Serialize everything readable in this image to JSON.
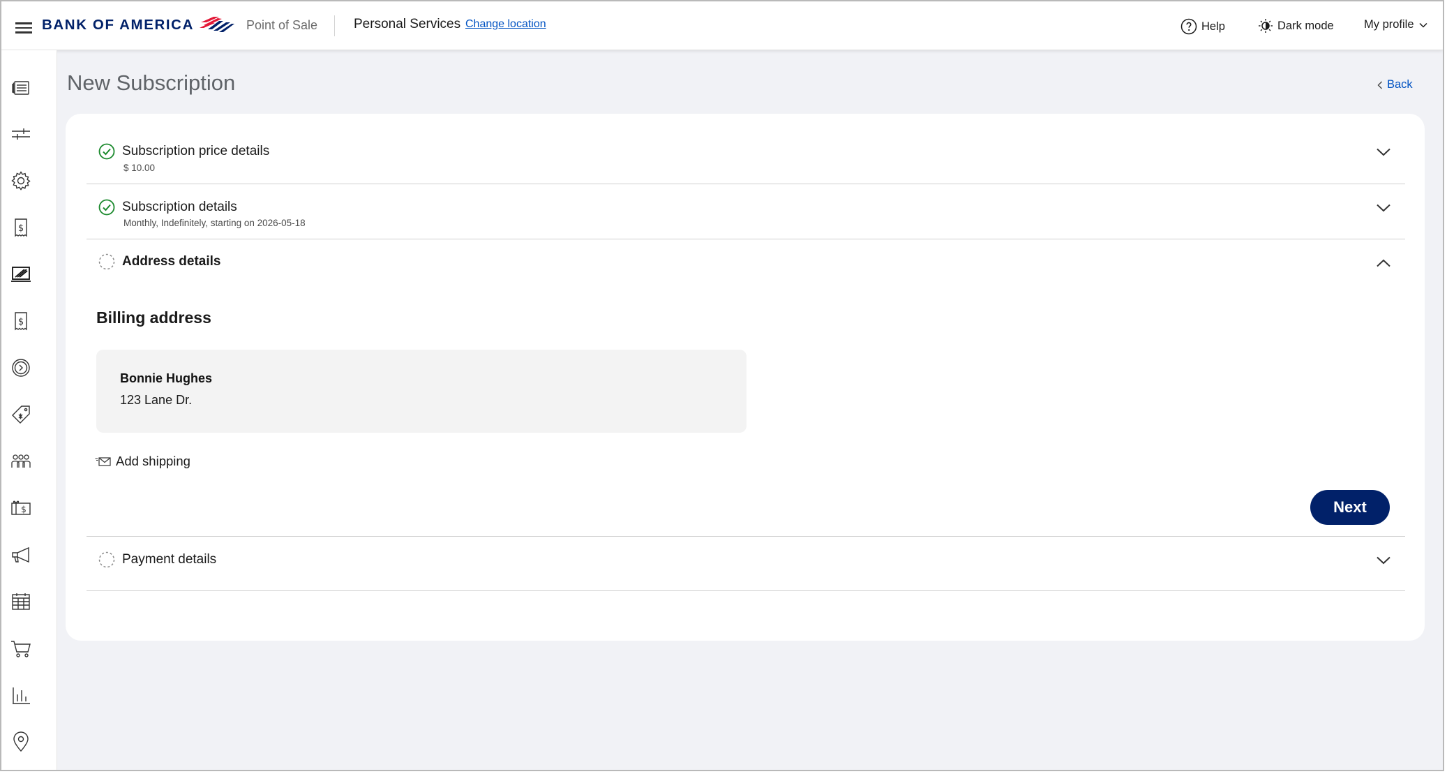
{
  "header": {
    "brand": "BANK OF AMERICA",
    "app_name": "Point of Sale",
    "location": "Personal Services",
    "change_location": "Change location",
    "help": "Help",
    "dark_mode": "Dark mode",
    "profile": "My profile"
  },
  "sidebar": {
    "items": [
      {
        "icon": "transactions-icon"
      },
      {
        "icon": "sliders-icon"
      },
      {
        "icon": "gear-icon"
      },
      {
        "icon": "invoice-icon"
      },
      {
        "icon": "terminal-icon"
      },
      {
        "icon": "bill-icon"
      },
      {
        "icon": "subscription-icon"
      },
      {
        "icon": "tag-icon"
      },
      {
        "icon": "customers-icon"
      },
      {
        "icon": "gift-card-icon"
      },
      {
        "icon": "megaphone-icon"
      },
      {
        "icon": "calendar-icon"
      },
      {
        "icon": "cart-icon"
      },
      {
        "icon": "reports-icon"
      },
      {
        "icon": "location-pin-icon"
      }
    ]
  },
  "page": {
    "title": "New Subscription",
    "back": "Back"
  },
  "steps": [
    {
      "title": "Subscription price details",
      "subtitle": "$ 10.00",
      "status": "complete"
    },
    {
      "title": "Subscription details",
      "subtitle": "Monthly, Indefinitely, starting on 2026-05-18",
      "status": "complete"
    },
    {
      "title": "Address details",
      "subtitle": "",
      "status": "active"
    },
    {
      "title": "Payment details",
      "subtitle": "",
      "status": "pending"
    }
  ],
  "address": {
    "section_title": "Billing address",
    "name": "Bonnie Hughes",
    "line1": "123 Lane Dr.",
    "add_shipping": "Add shipping",
    "next": "Next"
  },
  "colors": {
    "brand_navy": "#012169",
    "brand_red": "#e31837",
    "link_blue": "#0052c2",
    "success_green": "#1c8a2e",
    "page_bg": "#f1f2f6"
  }
}
